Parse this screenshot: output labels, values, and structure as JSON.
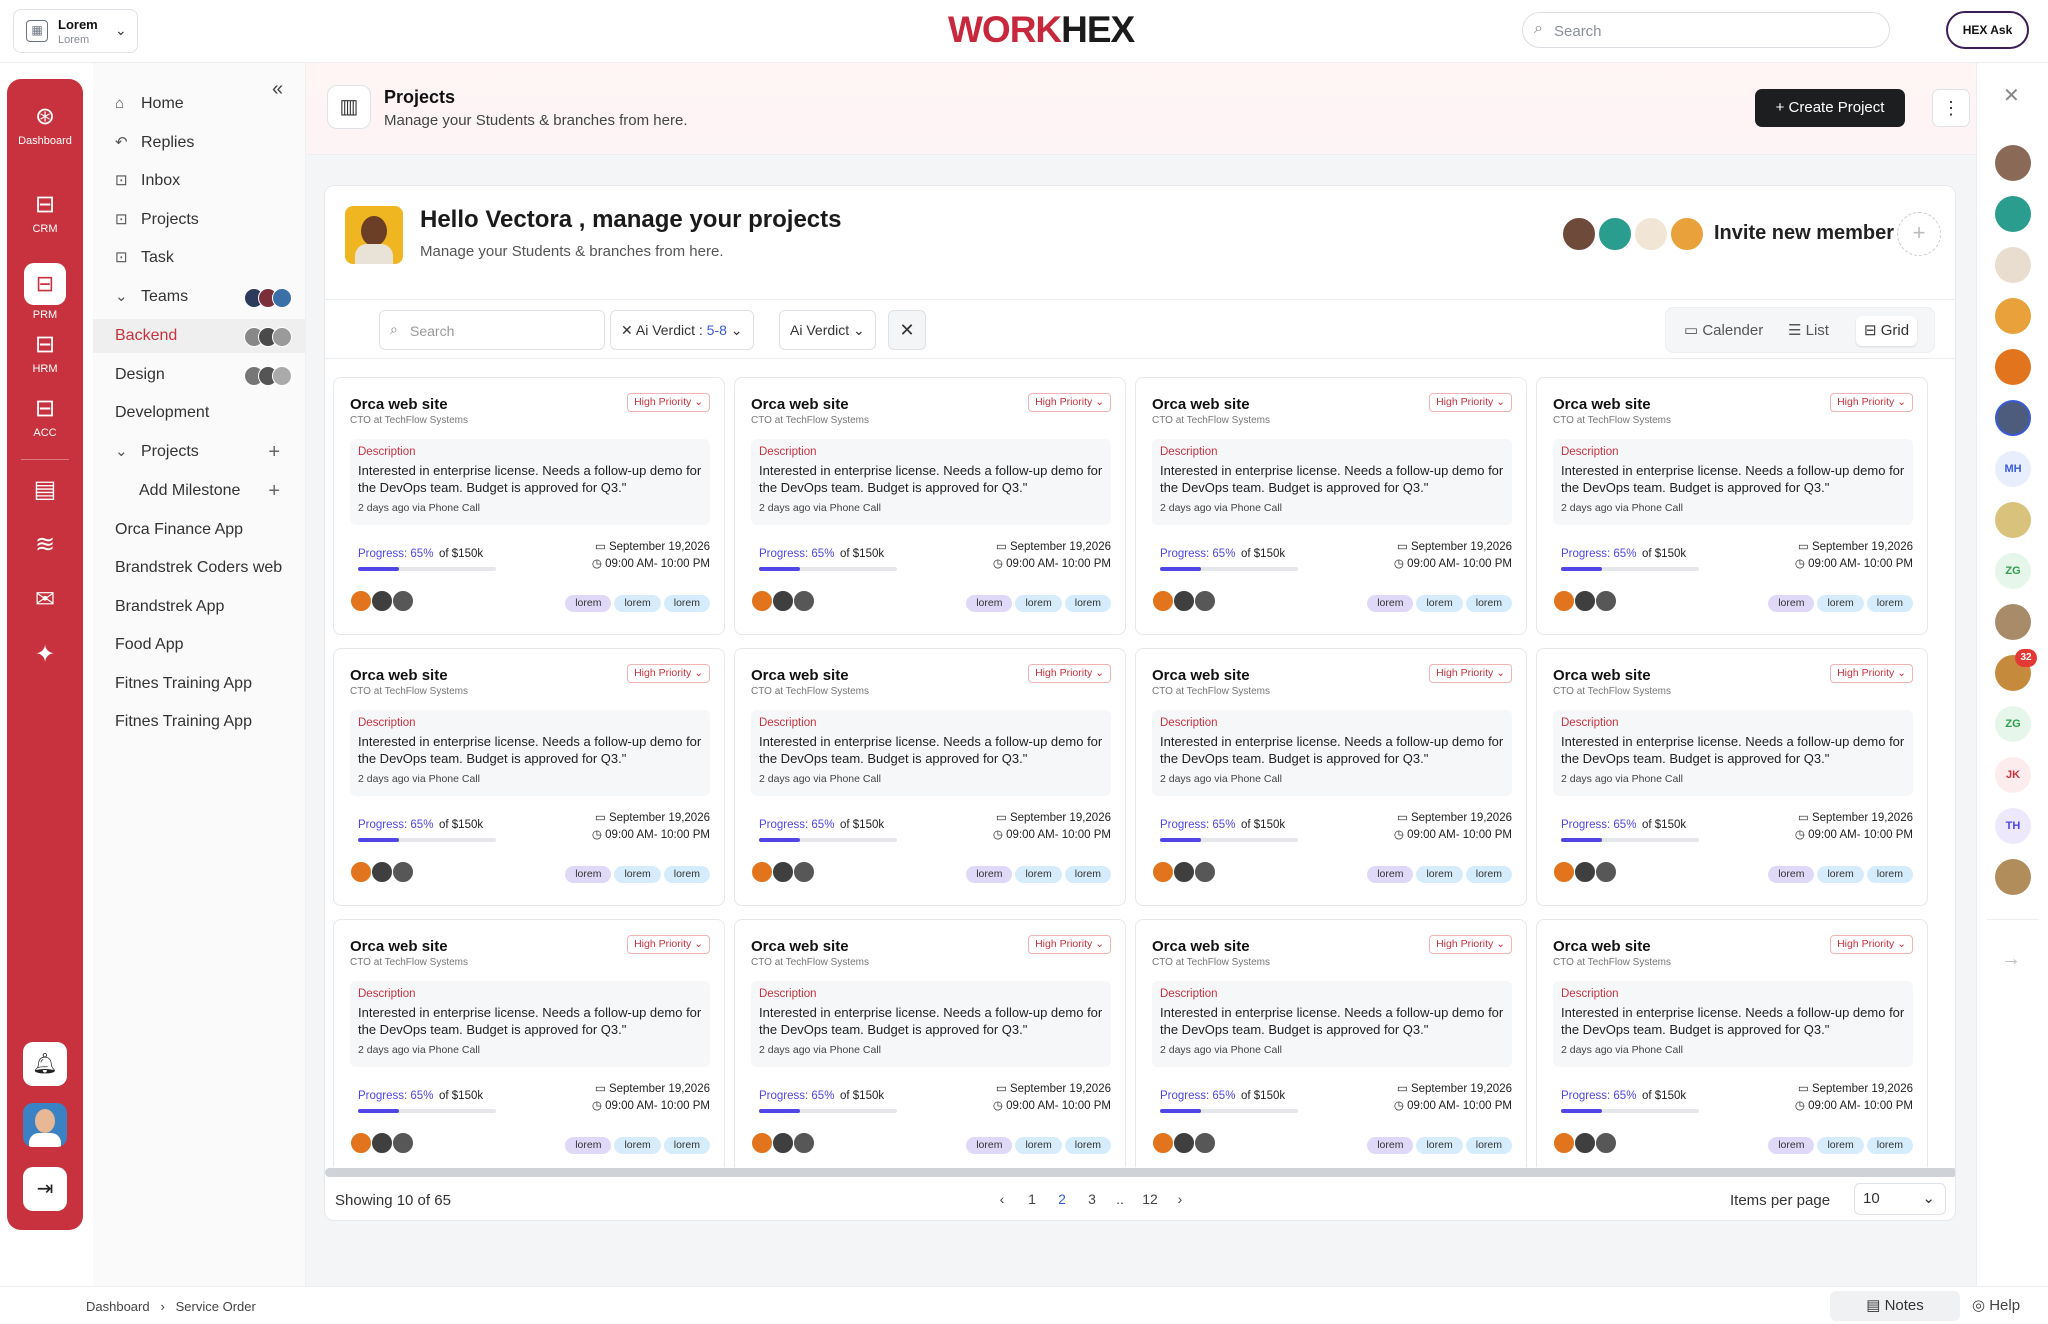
{
  "topbar": {
    "org_name": "Lorem",
    "org_sub": "Lorem",
    "logo_work": "WORK",
    "logo_hex": "HEX",
    "search_placeholder": "Search",
    "ask_label": "HEX Ask"
  },
  "rail": {
    "items": [
      {
        "label": "Dashboard",
        "icon": "dashboard-icon"
      },
      {
        "label": "CRM",
        "icon": "briefcase-icon"
      },
      {
        "label": "PRM",
        "icon": "briefcase-icon"
      },
      {
        "label": "HRM",
        "icon": "briefcase-icon"
      },
      {
        "label": "ACC",
        "icon": "briefcase-icon"
      }
    ]
  },
  "nav": {
    "home": "Home",
    "replies": "Replies",
    "inbox": "Inbox",
    "projects": "Projects",
    "task": "Task",
    "teams": "Teams",
    "backend": "Backend",
    "design": "Design",
    "development": "Development",
    "projects_group": "Projects",
    "add_milestone": "Add Milestone",
    "apps": [
      "Orca Finance App",
      "Brandstrek Coders web",
      "Brandstrek App",
      "Food App",
      "Fitnes Training App",
      "Fitnes Training App"
    ]
  },
  "header": {
    "title": "Projects",
    "subtitle": "Manage your Students & branches from here.",
    "create_label": "Create Project"
  },
  "panel": {
    "hello": "Hello Vectora , manage your projects",
    "hello_sub": "Manage your Students & branches from here.",
    "invite": "Invite new member"
  },
  "filters": {
    "search_placeholder": "Search",
    "chip1_label": "Ai Verdict :",
    "chip1_value": "5-8",
    "chip2_label": "Ai Verdict",
    "views": [
      "Calender",
      "List",
      "Grid"
    ],
    "active_view": "Grid"
  },
  "card": {
    "title": "Orca web site",
    "subtitle": "CTO at TechFlow Systems",
    "priority": "High Priority",
    "desc_label": "Description",
    "desc_text": "Interested in enterprise license. Needs a follow-up demo for the DevOps team. Budget is approved for Q3.\"",
    "meta": "2 days ago via Phone Call",
    "progress_label": "Progress: 65%",
    "progress_of": "of $150k",
    "progress_fraction": 0.3,
    "date": "September 19,2026",
    "time": "09:00 AM- 10:00 PM",
    "tags": [
      "lorem",
      "lorem",
      "lorem"
    ]
  },
  "pagination": {
    "showing": "Showing 10 of 65",
    "pages": [
      "1",
      "2",
      "3",
      "..",
      "12"
    ],
    "current": "2",
    "items_per_page_label": "Items per page",
    "items_per_page": "10"
  },
  "right_col": {
    "initials": [
      "MH",
      "ZG",
      "ZG",
      "JK",
      "TH"
    ],
    "badge": "32"
  },
  "bottom": {
    "crumb1": "Dashboard",
    "crumb2": "Service Order",
    "notes": "Notes",
    "help": "Help"
  },
  "colors": {
    "brand_red": "#c8323f",
    "accent_blue": "#4f46e5"
  }
}
